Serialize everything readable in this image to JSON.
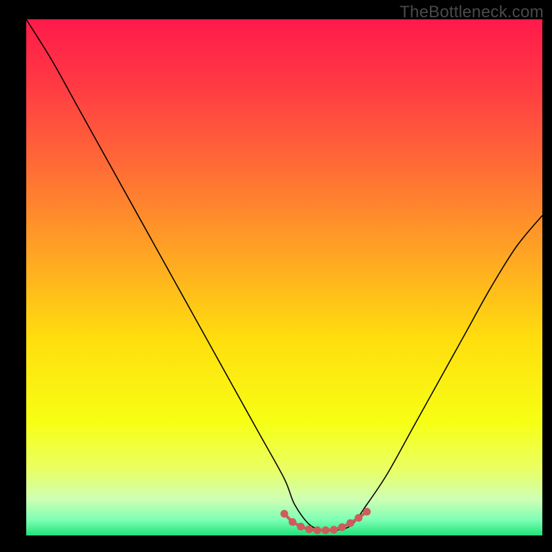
{
  "watermark": "TheBottleneck.com",
  "chart_data": {
    "type": "line",
    "title": "",
    "xlabel": "",
    "ylabel": "",
    "xlim": [
      0,
      100
    ],
    "ylim": [
      0,
      100
    ],
    "grid": false,
    "legend": false,
    "background_gradient": {
      "type": "vertical",
      "stops": [
        {
          "pos": 0.0,
          "color": "#ff1a4a"
        },
        {
          "pos": 0.12,
          "color": "#ff3844"
        },
        {
          "pos": 0.28,
          "color": "#ff6a36"
        },
        {
          "pos": 0.45,
          "color": "#ffa324"
        },
        {
          "pos": 0.62,
          "color": "#ffde0e"
        },
        {
          "pos": 0.78,
          "color": "#f7ff14"
        },
        {
          "pos": 0.87,
          "color": "#eaff62"
        },
        {
          "pos": 0.93,
          "color": "#ceffb4"
        },
        {
          "pos": 0.97,
          "color": "#7dffb4"
        },
        {
          "pos": 1.0,
          "color": "#22e27a"
        }
      ]
    },
    "series": [
      {
        "name": "bottleneck-curve",
        "color": "#000000",
        "x": [
          0,
          5,
          10,
          15,
          20,
          25,
          30,
          35,
          40,
          45,
          50,
          52,
          55,
          58,
          60,
          63,
          66,
          70,
          75,
          80,
          85,
          90,
          95,
          100
        ],
        "y": [
          100,
          92,
          83,
          74,
          65,
          56,
          47,
          38,
          29,
          20,
          11,
          6,
          2,
          1,
          1,
          2,
          6,
          12,
          21,
          30,
          39,
          48,
          56,
          62
        ]
      }
    ],
    "flat_zone": {
      "name": "optimal-band-markers",
      "color": "#cd5c5c",
      "x": [
        50,
        51.6,
        53.2,
        54.8,
        56.4,
        58,
        59.6,
        61.2,
        62.8,
        64.4,
        66
      ],
      "y": [
        4.2,
        2.6,
        1.7,
        1.2,
        1.0,
        1.0,
        1.1,
        1.6,
        2.4,
        3.4,
        4.6
      ]
    }
  }
}
